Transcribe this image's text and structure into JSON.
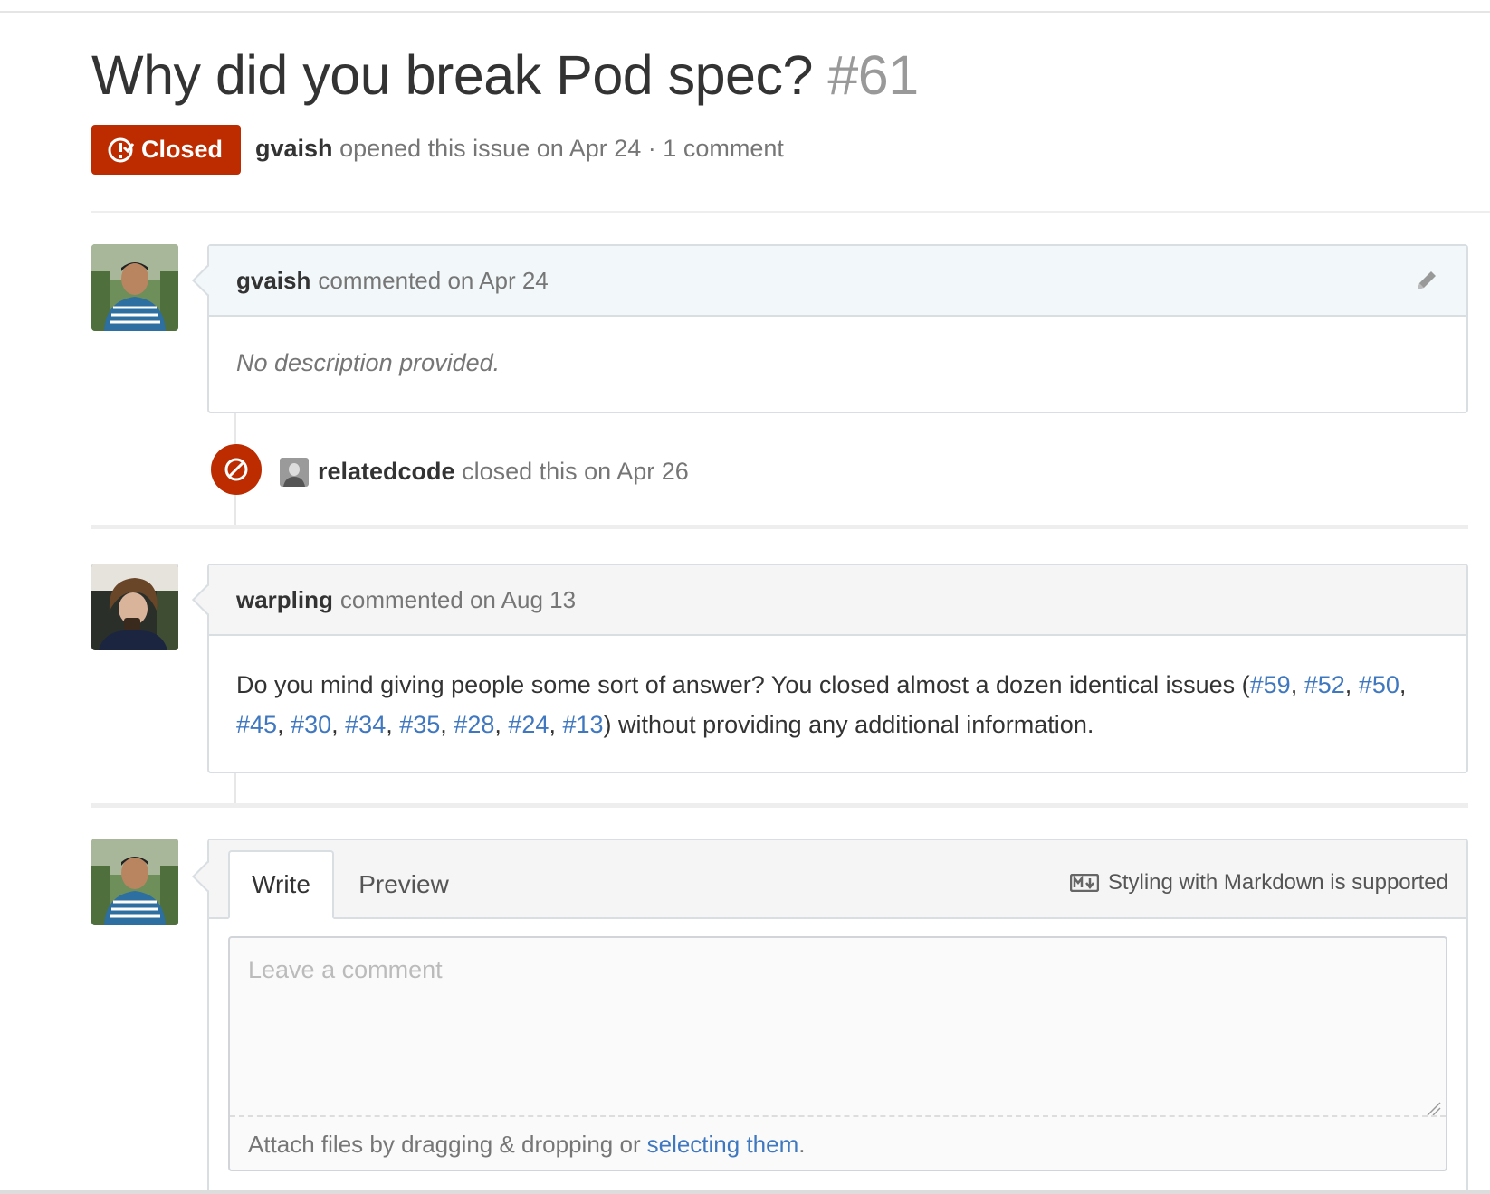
{
  "issue": {
    "title": "Why did you break Pod spec?",
    "number": "#61",
    "state": "Closed",
    "author": "gvaish",
    "meta_text": "opened this issue on Apr 24 · 1 comment"
  },
  "comments": [
    {
      "author": "gvaish",
      "action": "commented on Apr 24",
      "body": "No description provided."
    },
    {
      "author": "warpling",
      "action": "commented on Aug 13",
      "body_prefix": "Do you mind giving people some sort of answer? You closed almost a dozen identical issues (",
      "links": [
        "#59",
        "#52",
        "#50",
        "#45",
        "#30",
        "#34",
        "#35",
        "#28",
        "#24",
        "#13"
      ],
      "body_suffix": ") without providing any additional information."
    }
  ],
  "event": {
    "actor": "relatedcode",
    "action": "closed this on Apr 26"
  },
  "editor": {
    "tab_write": "Write",
    "tab_preview": "Preview",
    "markdown_note": "Styling with Markdown is supported",
    "placeholder": "Leave a comment",
    "attach_text": "Attach files by dragging & dropping or ",
    "attach_link": "selecting them",
    "attach_end": "."
  },
  "colors": {
    "closed_red": "#bd2c00",
    "link_blue": "#4078c0"
  },
  "icons": [
    "issue-closed-icon",
    "pencil-icon",
    "circle-slash-icon",
    "markdown-icon"
  ]
}
